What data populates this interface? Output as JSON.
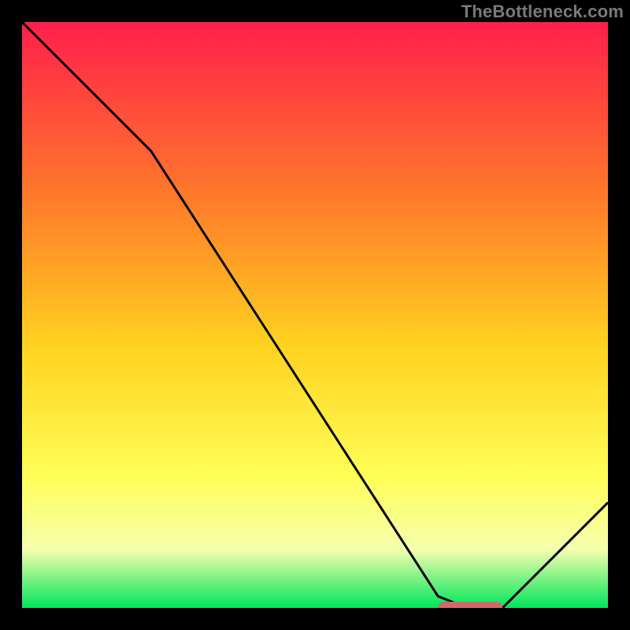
{
  "watermark": "TheBottleneck.com",
  "colors": {
    "frame": "#000000",
    "watermark_text": "#7a7a7a",
    "gradient_top": "#ff1f4b",
    "gradient_mid1": "#ff7a2a",
    "gradient_mid2": "#ffd21f",
    "gradient_mid3": "#ffff5a",
    "gradient_mid4": "#f6ffb0",
    "gradient_bottom": "#00e65a",
    "curve_stroke": "#000000",
    "marker_fill": "#d06a6a"
  },
  "chart_data": {
    "type": "line",
    "title": "",
    "xlabel": "",
    "ylabel": "",
    "xlim": [
      0,
      100
    ],
    "ylim": [
      0,
      100
    ],
    "x": [
      0,
      22,
      71,
      76,
      82,
      100
    ],
    "values": [
      100,
      78,
      2,
      0,
      0,
      18
    ],
    "marker": {
      "x_start": 71,
      "x_end": 82,
      "y": 0
    },
    "annotations": []
  }
}
